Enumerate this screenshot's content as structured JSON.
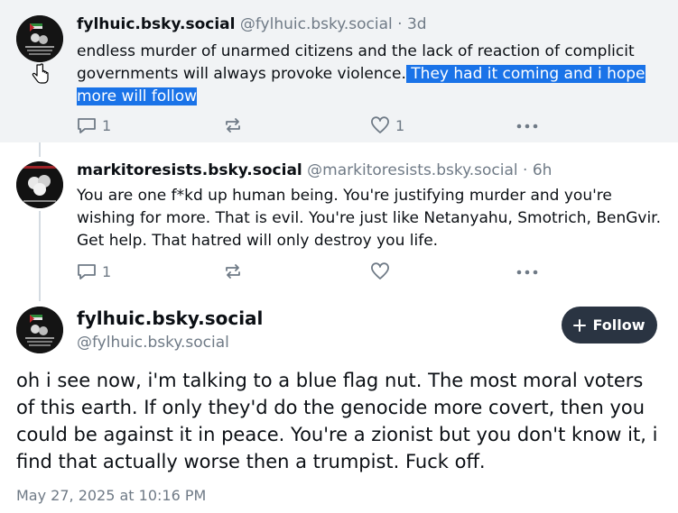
{
  "posts": [
    {
      "name": "fylhuic.bsky.social",
      "handle": "@fylhuic.bsky.social",
      "time": "· 3d",
      "text_plain": "endless murder of unarmed citizens and the lack of reaction of complicit governments will always provoke violence.",
      "text_selected": " They had it coming and i hope more will follow ",
      "reply_count": "1",
      "like_count": "1",
      "icons": [
        "reply-icon",
        "repost-icon",
        "like-icon",
        "more-icon"
      ]
    },
    {
      "name": "markitoresists.bsky.social",
      "handle": "@markitoresists.bsky.social",
      "time": "· 6h",
      "text": "You are one f*kd up human being. You're justifying murder and you're wishing for more. That is evil.  You're just like Netanyahu, Smotrich, BenGvir.  Get help. That hatred will only destroy you life.",
      "reply_count": "1",
      "like_count": ""
    }
  ],
  "main_post": {
    "name": "fylhuic.bsky.social",
    "handle": "@fylhuic.bsky.social",
    "follow_label": "Follow",
    "text": "oh i see now, i'm talking to a blue flag nut. The most moral voters of this earth. If only they'd do the genocide more covert, then you could be against it in peace. You're a zionist but you don't know it, i find that actually worse then a trumpist. Fuck off.",
    "date": "May 27, 2025 at 10:16 PM"
  },
  "colors": {
    "selection": "#1a73e8",
    "follow_button": "#2a3442",
    "muted_text": "#6f7a86",
    "highlight_bg": "#f1f3f5"
  }
}
